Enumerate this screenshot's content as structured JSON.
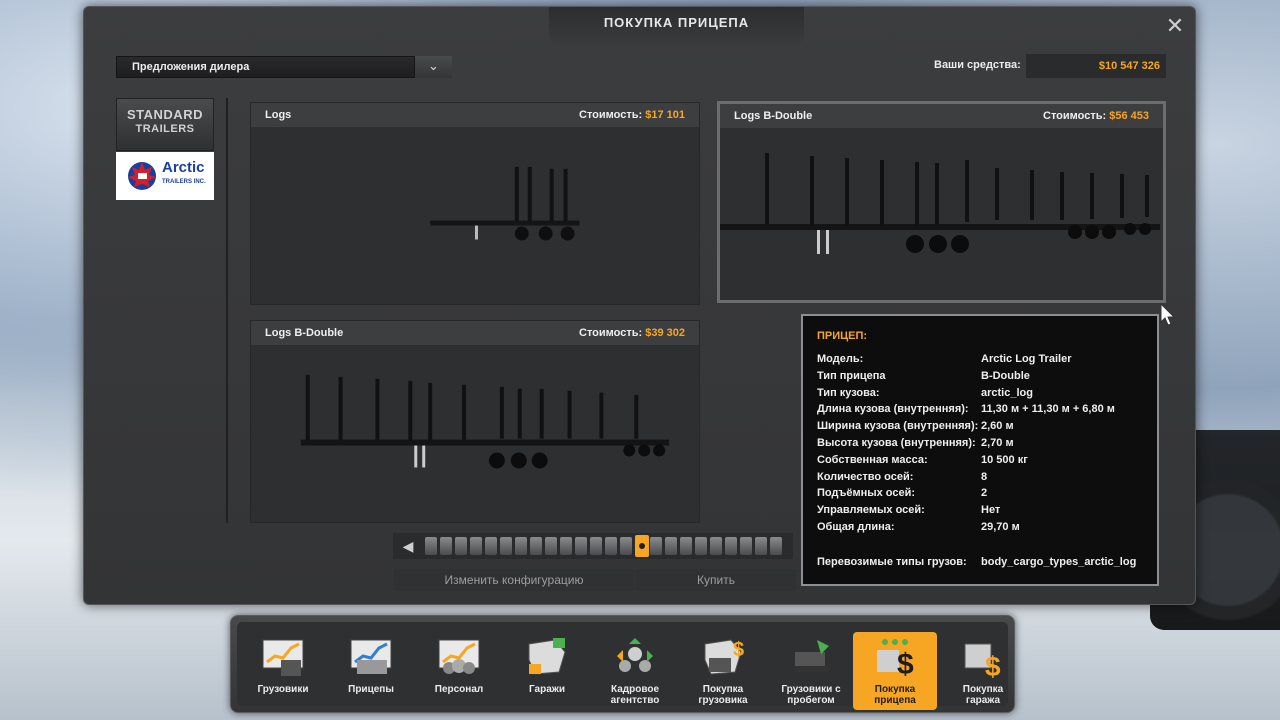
{
  "window": {
    "title": "ПОКУПКА ПРИЦЕПА",
    "close_icon": "close-icon"
  },
  "dealer": {
    "selected": "Предложения дилера"
  },
  "funds": {
    "label": "Ваши средства:",
    "value": "$10 547 326"
  },
  "brands": [
    {
      "line1": "STANDARD",
      "line2": "TRAILERS"
    },
    {
      "word": "Arctic",
      "sub": "TRAILERS INC."
    }
  ],
  "cost_label": "Стоимость:",
  "trailers": [
    {
      "name": "Logs",
      "cost": "$17 101"
    },
    {
      "name": "Logs B-Double",
      "cost": "$56 453"
    },
    {
      "name": "Logs B-Double",
      "cost": "$39 302"
    }
  ],
  "tooltip": {
    "header": "ПРИЦЕП:",
    "rows": [
      {
        "k": "Модель:",
        "v": "Arctic Log Trailer"
      },
      {
        "k": "Тип прицепа",
        "v": "B-Double"
      },
      {
        "k": "Тип кузова:",
        "v": "arctic_log"
      },
      {
        "k": "Длина кузова (внутренняя):",
        "v": "11,30 м + 11,30 м + 6,80 м"
      },
      {
        "k": "Ширина кузова (внутренняя):",
        "v": "2,60 м"
      },
      {
        "k": "Высота кузова (внутренняя):",
        "v": "2,70 м"
      },
      {
        "k": "Собственная масса:",
        "v": "10 500 кг"
      },
      {
        "k": "Количество осей:",
        "v": "8"
      },
      {
        "k": "Подъёмных осей:",
        "v": "2"
      },
      {
        "k": "Управляемых осей:",
        "v": "Нет"
      },
      {
        "k": "Общая длина:",
        "v": "29,70 м"
      }
    ],
    "cargo_label": "Перевозимые типы грузов:",
    "cargo_value": "body_cargo_types_arctic_log"
  },
  "actions": {
    "configure": "Изменить конфигурацию",
    "buy": "Купить"
  },
  "nav": [
    {
      "label": "Грузовики",
      "icon": "trucks-chart-icon"
    },
    {
      "label": "Прицепы",
      "icon": "trailers-chart-icon"
    },
    {
      "label": "Персонал",
      "icon": "staff-chart-icon"
    },
    {
      "label": "Гаражи",
      "icon": "garages-map-icon"
    },
    {
      "label": "Кадровое\nагентство",
      "icon": "recruitment-agency-icon"
    },
    {
      "label": "Покупка\nгрузовика",
      "icon": "buy-truck-icon"
    },
    {
      "label": "Грузовики с\nпробегом",
      "icon": "used-trucks-icon"
    },
    {
      "label": "Покупка\nприцепа",
      "icon": "buy-trailer-icon"
    },
    {
      "label": "Покупка\nгаража",
      "icon": "buy-garage-icon"
    }
  ],
  "colors": {
    "accent": "#f6a623",
    "panel": "#333436",
    "tooltip_bg": "#0d0d0e"
  }
}
